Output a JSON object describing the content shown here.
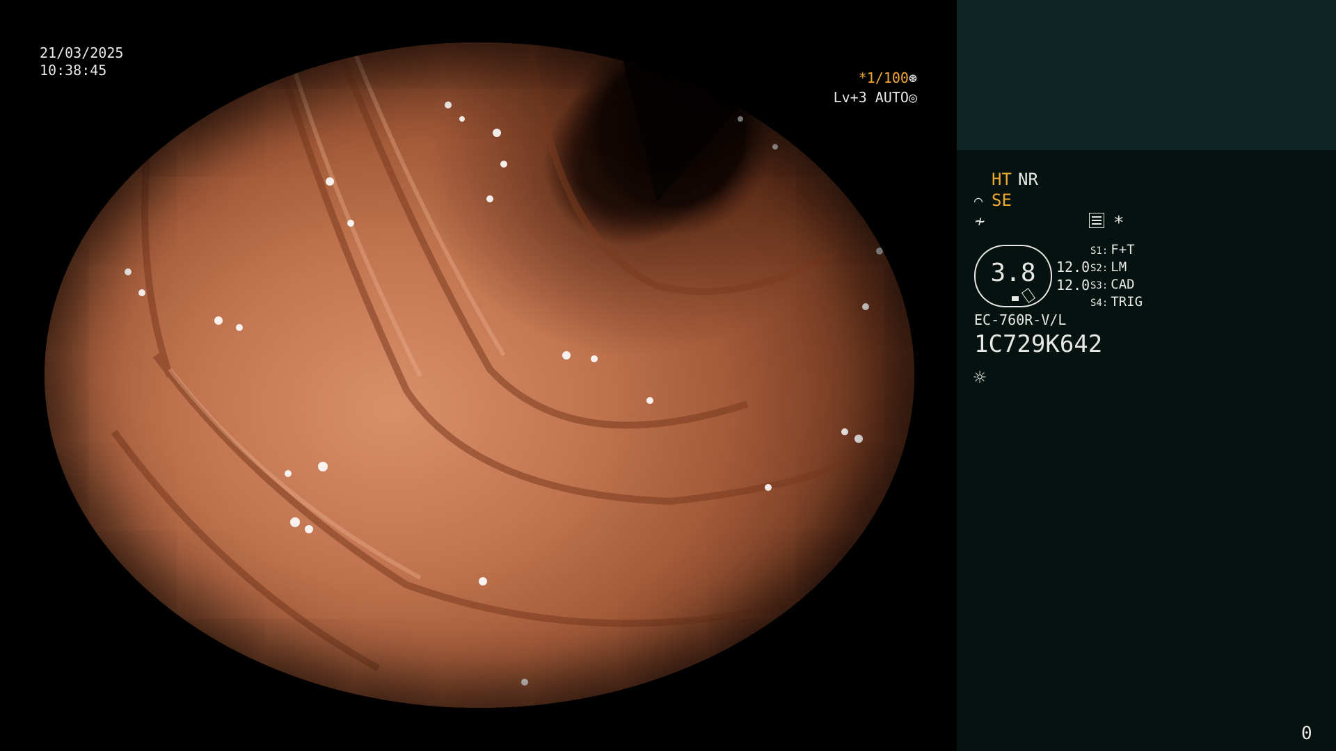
{
  "overlay": {
    "date": "21/03/2025",
    "time": "10:38:45",
    "shutter": "*1/100",
    "shutter_icon": "⊛",
    "iris_level": "Lv+3 AUTO",
    "iris_icon": "◎"
  },
  "panel": {
    "ht": "HT",
    "nr": "NR",
    "se_icon": "⌒",
    "se": "SE",
    "filter_icon": "≁",
    "asterisk": "*",
    "scope_value": "3.8",
    "values": [
      "12.0",
      "12.0"
    ],
    "switch_labels": [
      "S1:",
      "S2:",
      "S3:",
      "S4:"
    ],
    "switches": [
      "F+T",
      "LM",
      "CAD",
      "TRIG"
    ],
    "model": "EC-760R-V/L",
    "serial": "1C729K642",
    "light_icon": "☼",
    "counter": "0"
  },
  "colors": {
    "accent": "#f0a830",
    "text": "#e8e8e8",
    "panel_bg": "#051210",
    "panel_top": "#0f2526"
  },
  "icons": [
    "shutter-icon",
    "iris-icon",
    "se-icon",
    "filter-icon",
    "menu-icon",
    "asterisk-icon",
    "light-icon"
  ]
}
